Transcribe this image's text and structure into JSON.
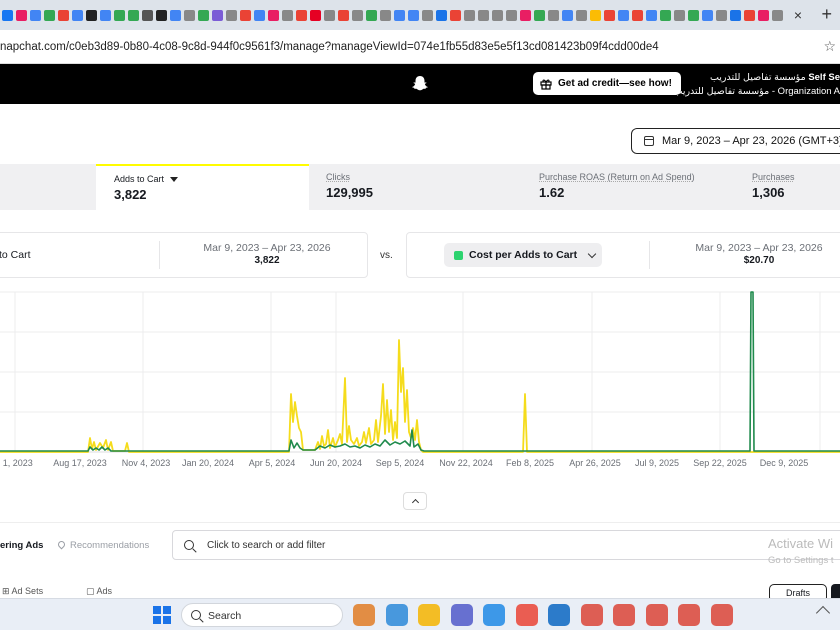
{
  "browser": {
    "address": "napchat.com/c0eb3d89-0b80-4c08-9c8d-944f0c9561f3/manage?manageViewId=074e1fb55d83e5e5f13cd081423b09f4cdd00de4",
    "tab_colors": [
      "#1877f2",
      "#e91e63",
      "#4285f4",
      "#34a853",
      "#ea4335",
      "#4285f4",
      "#222222",
      "#4285f4",
      "#34a853",
      "#34a853",
      "#555555",
      "#222222",
      "#4285f4",
      "#888888",
      "#34a853",
      "#7b5cd6",
      "#888888",
      "#ea4335",
      "#4285f4",
      "#e91e63",
      "#888888",
      "#ea4335",
      "#e60023",
      "#888888",
      "#ea4335",
      "#888888",
      "#34a853",
      "#888888",
      "#4285f4",
      "#4285f4",
      "#888888",
      "#1a73e8",
      "#ea4335",
      "#888888",
      "#888888",
      "#888888",
      "#888888",
      "#e91e63",
      "#34a853",
      "#888888",
      "#4285f4",
      "#888888",
      "#fbbc04",
      "#ea4335",
      "#4285f4",
      "#ea4335",
      "#4285f4",
      "#34a853",
      "#888888",
      "#34a853",
      "#4285f4",
      "#888888",
      "#1a73e8",
      "#ea4335",
      "#e91e63",
      "#888888"
    ]
  },
  "header": {
    "ad_credit_label": "Get ad credit—see how!",
    "org_line1": "مؤسسة تفاصيل للتدريب",
    "org_line1_prefix": "Self Se",
    "org_line2": "مؤسسة تفاصيل للتدريب - Organization A"
  },
  "date_range": "Mar 9, 2023 – Apr 23, 2026 (GMT+3)",
  "metrics": [
    {
      "label": "Adds to Cart",
      "value": "3,822",
      "active": true
    },
    {
      "label": "Clicks",
      "value": "129,995"
    },
    {
      "label": "Purchase ROAS (Return on Ad Spend)",
      "value": "1.62"
    },
    {
      "label": "Purchases",
      "value": "1,306"
    }
  ],
  "compare": {
    "left_label": "to Cart",
    "left_range": "Mar 9, 2023 – Apr 23, 2026",
    "left_value": "3,822",
    "vs": "vs.",
    "metric": "Cost per Adds to Cart",
    "right_range": "Mar 9, 2023 – Apr 23, 2026",
    "right_value": "$20.70"
  },
  "chart_data": {
    "type": "line",
    "x_ticks": [
      "n 1, 2023",
      "Aug 17, 2023",
      "Nov 4, 2023",
      "Jan 20, 2024",
      "Apr 5, 2024",
      "Jun 20, 2024",
      "Sep 5, 2024",
      "Nov 22, 2024",
      "Feb 8, 2025",
      "Apr 26, 2025",
      "Jul 9, 2025",
      "Sep 22, 2025",
      "Dec 9, 2025"
    ],
    "grid": true,
    "series": [
      {
        "name": "Adds to Cart",
        "color": "#f5dc1c",
        "points": [
          [
            0,
            0
          ],
          [
            88,
            0
          ],
          [
            90,
            14
          ],
          [
            92,
            3
          ],
          [
            94,
            10
          ],
          [
            96,
            2
          ],
          [
            100,
            9
          ],
          [
            103,
            4
          ],
          [
            106,
            12
          ],
          [
            108,
            2
          ],
          [
            111,
            10
          ],
          [
            113,
            1
          ],
          [
            125,
            1
          ],
          [
            127,
            9
          ],
          [
            129,
            0
          ],
          [
            289,
            0
          ],
          [
            291,
            58
          ],
          [
            293,
            30
          ],
          [
            295,
            50
          ],
          [
            297,
            36
          ],
          [
            299,
            24
          ],
          [
            301,
            20
          ],
          [
            303,
            2
          ],
          [
            315,
            2
          ],
          [
            318,
            10
          ],
          [
            320,
            3
          ],
          [
            322,
            16
          ],
          [
            324,
            6
          ],
          [
            326,
            8
          ],
          [
            328,
            22
          ],
          [
            330,
            4
          ],
          [
            333,
            14
          ],
          [
            335,
            5
          ],
          [
            338,
            12
          ],
          [
            340,
            18
          ],
          [
            342,
            8
          ],
          [
            345,
            74
          ],
          [
            347,
            10
          ],
          [
            349,
            26
          ],
          [
            351,
            12
          ],
          [
            354,
            8
          ],
          [
            357,
            14
          ],
          [
            359,
            6
          ],
          [
            362,
            10
          ],
          [
            364,
            20
          ],
          [
            366,
            9
          ],
          [
            369,
            24
          ],
          [
            371,
            8
          ],
          [
            374,
            12
          ],
          [
            376,
            32
          ],
          [
            378,
            10
          ],
          [
            381,
            36
          ],
          [
            383,
            68
          ],
          [
            385,
            18
          ],
          [
            387,
            52
          ],
          [
            389,
            20
          ],
          [
            391,
            42
          ],
          [
            393,
            12
          ],
          [
            395,
            30
          ],
          [
            397,
            14
          ],
          [
            399,
            112
          ],
          [
            401,
            60
          ],
          [
            403,
            84
          ],
          [
            405,
            30
          ],
          [
            407,
            62
          ],
          [
            409,
            20
          ],
          [
            411,
            14
          ],
          [
            413,
            24
          ],
          [
            415,
            12
          ],
          [
            417,
            32
          ],
          [
            419,
            10
          ],
          [
            421,
            2
          ],
          [
            423,
            0
          ],
          [
            523,
            0
          ],
          [
            525,
            58
          ],
          [
            527,
            0
          ],
          [
            840,
            0
          ]
        ]
      },
      {
        "name": "Cost per Adds to Cart",
        "color": "#1f8a4c",
        "points": [
          [
            0,
            1
          ],
          [
            88,
            1
          ],
          [
            90,
            5
          ],
          [
            93,
            2
          ],
          [
            96,
            4
          ],
          [
            99,
            2
          ],
          [
            102,
            5
          ],
          [
            105,
            2
          ],
          [
            108,
            4
          ],
          [
            111,
            1
          ],
          [
            289,
            1
          ],
          [
            291,
            12
          ],
          [
            294,
            4
          ],
          [
            297,
            9
          ],
          [
            300,
            4
          ],
          [
            303,
            2
          ],
          [
            315,
            2
          ],
          [
            320,
            6
          ],
          [
            325,
            4
          ],
          [
            330,
            7
          ],
          [
            335,
            5
          ],
          [
            340,
            6
          ],
          [
            345,
            8
          ],
          [
            350,
            5
          ],
          [
            355,
            6
          ],
          [
            360,
            4
          ],
          [
            365,
            7
          ],
          [
            370,
            5
          ],
          [
            375,
            8
          ],
          [
            380,
            6
          ],
          [
            385,
            12
          ],
          [
            390,
            7
          ],
          [
            395,
            10
          ],
          [
            400,
            8
          ],
          [
            405,
            11
          ],
          [
            410,
            6
          ],
          [
            412,
            22
          ],
          [
            414,
            5
          ],
          [
            418,
            8
          ],
          [
            421,
            2
          ],
          [
            424,
            1
          ],
          [
            750,
            1
          ],
          [
            751,
            160
          ],
          [
            753,
            160
          ],
          [
            754,
            1
          ],
          [
            840,
            1
          ]
        ]
      }
    ]
  },
  "filters": {
    "tab1": "ering Ads",
    "tab2": "Recommendations",
    "search_placeholder": "Click to search or add filter",
    "activate_title": "Activate Wi",
    "activate_sub": "Go to Settings t"
  },
  "bottom_tabs": {
    "ad_sets": "Ad Sets",
    "ads": "Ads",
    "drafts": "Drafts"
  },
  "taskbar": {
    "search": "Search",
    "apps": [
      "#e07b24",
      "#2b88d8",
      "#f4b400",
      "#5059c9",
      "#1e88e5",
      "#ea4335",
      "#0a66c2",
      "#db4437",
      "#db4437",
      "#db4437",
      "#db4437",
      "#db4437"
    ]
  }
}
